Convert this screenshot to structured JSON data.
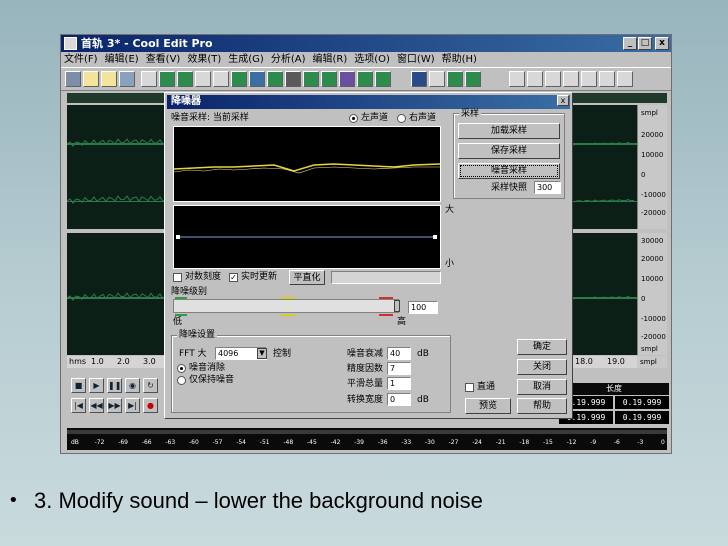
{
  "window": {
    "title": "首轨 3* - Cool Edit Pro",
    "min": "_",
    "max": "□",
    "close": "x"
  },
  "menu": [
    "文件(F)",
    "编辑(E)",
    "查看(V)",
    "效果(T)",
    "生成(G)",
    "分析(A)",
    "编辑(R)",
    "选项(O)",
    "窗口(W)",
    "帮助(H)"
  ],
  "scale_top": [
    "smpl",
    "20000",
    "10000",
    "0",
    "-10000",
    "-20000",
    "-30000"
  ],
  "scale_bottom": [
    "30000",
    "20000",
    "10000",
    "0",
    "-10000",
    "-20000",
    "smpl"
  ],
  "ruler": {
    "unit": "hms",
    "ticks": [
      "1.0",
      "2.0",
      "3.0",
      "18.0",
      "19.0",
      "smpl"
    ]
  },
  "time_panel": {
    "header": "长度",
    "rows": [
      [
        "0.19.999",
        "0.19.999"
      ],
      [
        "0.19.999",
        "0.19.999"
      ]
    ]
  },
  "meter_ticks": [
    "dB",
    "-72",
    "-69",
    "-66",
    "-63",
    "-60",
    "-57",
    "-54",
    "-51",
    "-48",
    "-45",
    "-42",
    "-39",
    "-36",
    "-33",
    "-30",
    "-27",
    "-24",
    "-21",
    "-18",
    "-15",
    "-12",
    "-9",
    "-6",
    "-3",
    "0"
  ],
  "dialog": {
    "title": "降噪器",
    "close": "x",
    "profile_label": "噪音采样: 当前采样",
    "channel_left": "左声道",
    "channel_right": "右声道",
    "sample_group": "采样",
    "load_button": "加载采样",
    "save_button": "保存采样",
    "noise_button": "噪音采样",
    "snapshots_label": "采样快照",
    "snapshots_value": "300",
    "high_label": "大",
    "low_label": "小",
    "log_scale": "对数刻度",
    "live_update": "实时更新",
    "flatten_button": "平直化",
    "level_label": "降噪级别",
    "level_low": "低",
    "level_high": "高",
    "level_value": "100",
    "settings_group": "降噪设置",
    "fft_label": "FFT 大",
    "fft_value": "4096",
    "control_label": "控制",
    "mode_remove": "噪音消除",
    "mode_keep": "仅保持噪音",
    "attenuation_label": "噪音衰减",
    "attenuation_value": "40",
    "db_unit": "dB",
    "precision_label": "精度因数",
    "precision_value": "7",
    "smoothing_label": "平滑总量",
    "smoothing_value": "1",
    "transition_label": "转换宽度",
    "transition_value": "0",
    "ok_button": "确定",
    "close_button": "关闭",
    "cancel_button": "取消",
    "bypass_label": "直通",
    "preview_button": "预览",
    "help_button": "帮助"
  },
  "caption": {
    "bullet": "•",
    "text": "3. Modify sound – lower the background noise"
  },
  "colors": {
    "titlebar": "#0a246a",
    "waveform": "#2d7a4b",
    "noise_curve": "#e8d63a",
    "dialog_bg": "#c0c0c0"
  }
}
